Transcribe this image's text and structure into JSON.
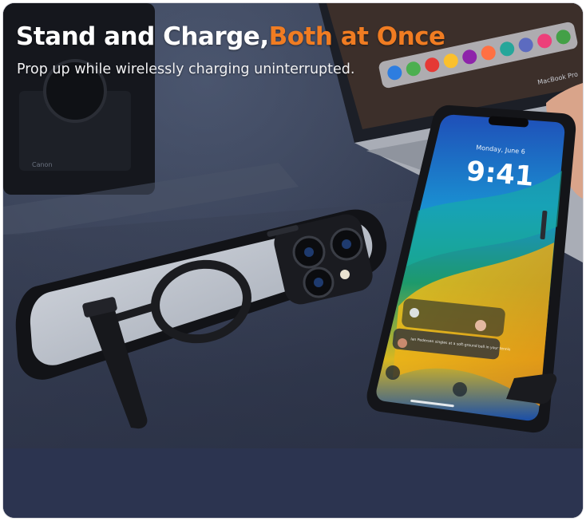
{
  "headline": {
    "part1": "Stand and Charge,",
    "part2": "Both at Once"
  },
  "subline": "Prop up while wirelessly charging uninterrupted.",
  "phone_screen": {
    "date": "Monday, June 6",
    "time": "9:41",
    "notification": "Ian Pedersen singles at a soft-ground ball in your tennis"
  },
  "laptop_label": "MacBook Pro",
  "camera_label": "Canon",
  "colors": {
    "accent": "#f07c22",
    "headline": "#ffffff",
    "background": "#2a3148"
  }
}
